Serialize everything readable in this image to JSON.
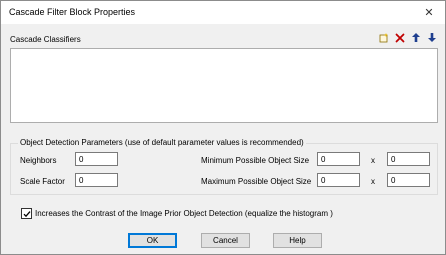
{
  "window": {
    "title": "Cascade Filter Block Properties",
    "close_glyph": "✕"
  },
  "classifiers": {
    "label": "Cascade Classifiers",
    "toolbar_icons": [
      "new-item-icon",
      "delete-icon",
      "move-up-icon",
      "move-down-icon"
    ]
  },
  "detection": {
    "group_title": "Object Detection Parameters  (use of default parameter values is recommended)",
    "neighbors_label": "Neighbors",
    "neighbors_value": "0",
    "scale_factor_label": "Scale Factor",
    "scale_factor_value": "0",
    "min_size_label": "Minimum Possible Object Size",
    "min_width_value": "0",
    "min_height_value": "0",
    "max_size_label": "Maximum Possible Object Size",
    "max_width_value": "0",
    "max_height_value": "0",
    "times_glyph": "x"
  },
  "contrast": {
    "label": "Increases the Contrast of the Image Prior Object Detection (equalize the histogram )",
    "checked": true
  },
  "buttons": {
    "ok": "OK",
    "cancel": "Cancel",
    "help": "Help"
  },
  "colors": {
    "accent": "#0078d7",
    "delete_icon": "#c00000",
    "arrow_icon": "#1f3f8f",
    "new_icon": "#d9a300"
  }
}
